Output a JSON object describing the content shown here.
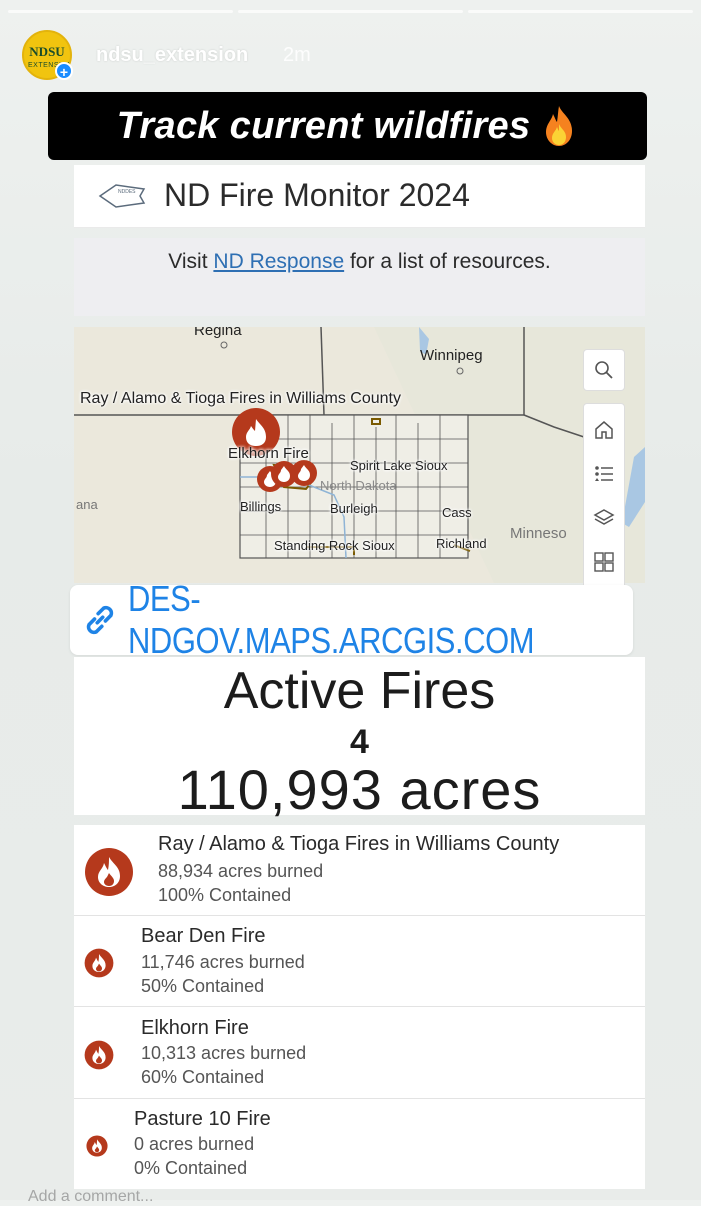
{
  "story": {
    "progress_segments": 3,
    "username": "ndsu_extension",
    "time": "2m",
    "avatar_text_top": "NDSU",
    "avatar_text_bottom": "EXTENSION",
    "banner_text": "Track current wildfires",
    "add_comment": "Add a comment..."
  },
  "app": {
    "title": "ND Fire Monitor 2024",
    "resources_prefix": "Visit ",
    "resources_link": "ND Response",
    "resources_suffix": " for a list of resources."
  },
  "map": {
    "labels": {
      "regina": "Regina",
      "winnipeg": "Winnipeg",
      "ray_alamo": "Ray / Alamo & Tioga Fires in Williams County",
      "elkhorn": "Elkhorn Fire",
      "spirit_lake": "Spirit Lake Sioux",
      "north_dakota": "North Dakota",
      "ana": "ana",
      "billings": "Billings",
      "burleigh": "Burleigh",
      "cass": "Cass",
      "minneso": "Minneso",
      "standing_rock": "Standing Rock Sioux",
      "richland": "Richland"
    },
    "tools": [
      "search-icon",
      "home-icon",
      "legend-icon",
      "layers-icon",
      "basemap-icon"
    ]
  },
  "link": {
    "url": "DES-NDGOV.MAPS.ARCGIS.COM"
  },
  "stats": {
    "heading": "Active Fires",
    "count": "4",
    "acres": "110,993 acres"
  },
  "fires": [
    {
      "name": "Ray / Alamo & Tioga Fires in Williams County",
      "acres": "88,934 acres burned",
      "contained": "100% Contained"
    },
    {
      "name": "Bear Den Fire",
      "acres": "11,746 acres burned",
      "contained": "50% Contained"
    },
    {
      "name": "Elkhorn Fire",
      "acres": "10,313 acres burned",
      "contained": "60% Contained"
    },
    {
      "name": "Pasture 10 Fire",
      "acres": "0 acres burned",
      "contained": "0% Contained"
    }
  ],
  "colors": {
    "fire_icon": "#b5391c",
    "link_blue": "#1e83e6",
    "resource_link": "#2e6fb3",
    "avatar_bg": "#f1c40f"
  }
}
